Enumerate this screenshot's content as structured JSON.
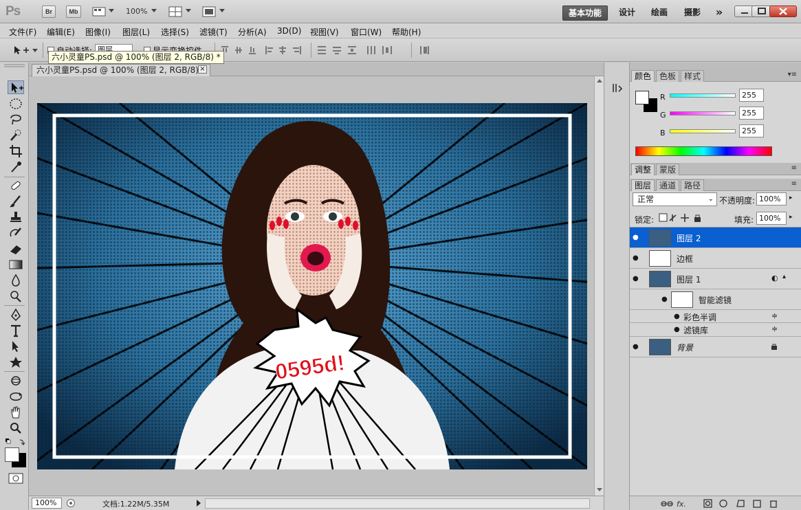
{
  "app": {
    "logo": "Ps",
    "bridge_label": "Br",
    "minibridge_label": "Mb",
    "zoom": "100%",
    "workspaces": [
      "基本功能",
      "设计",
      "绘画",
      "摄影"
    ],
    "more": "»"
  },
  "menu": [
    "文件(F)",
    "编辑(E)",
    "图像(I)",
    "图层(L)",
    "选择(S)",
    "滤镜(T)",
    "分析(A)",
    "3D(D)",
    "视图(V)",
    "窗口(W)",
    "帮助(H)"
  ],
  "options": {
    "autoselect_label": "自动选择:",
    "autoselect_value": "图层",
    "transform_label": "显示变换控件"
  },
  "tooltip": "六小灵童PS.psd @ 100% (图层 2, RGB/8) *",
  "document": {
    "tab_title": "六小灵童PS.psd @ 100% (图层 2, RGB/8) *",
    "close": "×",
    "burst_text": "0595d!"
  },
  "status": {
    "zoom": "100%",
    "doc_info": "文档:1.22M/5.35M"
  },
  "color_panel": {
    "tabs": [
      "颜色",
      "色板",
      "样式"
    ],
    "channels": [
      {
        "label": "R",
        "value": "255",
        "color": "#00e5e5"
      },
      {
        "label": "G",
        "value": "255",
        "color": "#e500e5"
      },
      {
        "label": "B",
        "value": "255",
        "color": "#e5e500"
      }
    ]
  },
  "adjust_panel": {
    "tabs": [
      "调整",
      "蒙版"
    ]
  },
  "layers_panel": {
    "tabs": [
      "图层",
      "通道",
      "路径"
    ],
    "blend_mode": "正常",
    "opacity_label": "不透明度:",
    "opacity": "100%",
    "lock_label": "锁定:",
    "fill_label": "填充:",
    "fill": "100%",
    "layers": [
      {
        "name": "图层 2",
        "selected": true
      },
      {
        "name": "边框",
        "selected": false
      },
      {
        "name": "图层 1",
        "selected": false
      },
      {
        "name": "智能滤镜",
        "selected": false
      },
      {
        "name": "彩色半调",
        "selected": false
      },
      {
        "name": "滤镜库",
        "selected": false
      },
      {
        "name": "背景",
        "selected": false
      }
    ]
  }
}
